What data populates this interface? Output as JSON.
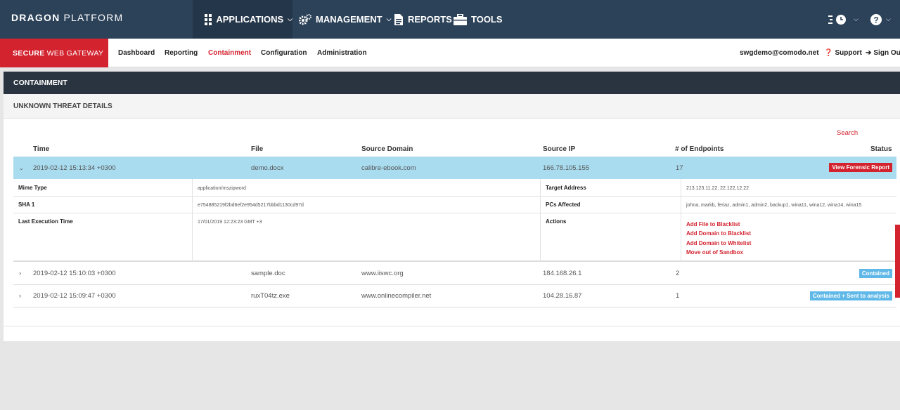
{
  "header": {
    "brand_bold": "DRAGON",
    "brand_light": "PLATFORM",
    "nav": [
      {
        "label": "APPLICATIONS",
        "icon": "grid-icon"
      },
      {
        "label": "MANAGEMENT",
        "icon": "gears-icon"
      },
      {
        "label": "REPORTS",
        "icon": "document-icon"
      },
      {
        "label": "TOOLS",
        "icon": "toolbox-icon"
      }
    ]
  },
  "subbar": {
    "product_bold": "SECURE",
    "product_light": "WEB GATEWAY",
    "nav": [
      "Dashboard",
      "Reporting",
      "Containment",
      "Configuration",
      "Administration"
    ],
    "active": "Containment",
    "user": "swgdemo@comodo.net",
    "support": "Support",
    "signout": "Sign Ou"
  },
  "panel": {
    "title": "CONTAINMENT",
    "subtitle": "UNKNOWN THREAT DETAILS",
    "search_label": "Search"
  },
  "table": {
    "headers": [
      "Time",
      "File",
      "Source Domain",
      "Source IP",
      "# of Endpoints",
      "Status"
    ],
    "rows": [
      {
        "time": "2019-02-12 15:13:34 +0300",
        "file": "demo.docx",
        "domain": "calibre-ebook.com",
        "ip": "166.78.105.155",
        "endpoints": "17",
        "status": "View Forensic Report",
        "expanded": true
      },
      {
        "time": "2019-02-12 15:10:03 +0300",
        "file": "sample.doc",
        "domain": "www.iiswc.org",
        "ip": "184.168.26.1",
        "endpoints": "2",
        "status": "Contained",
        "expanded": false
      },
      {
        "time": "2019-02-12 15:09:47 +0300",
        "file": "ruxT04tz.exe",
        "domain": "www.onlinecompiler.net",
        "ip": "104.28.16.87",
        "endpoints": "1",
        "status": "Contained + Sent to analysis",
        "expanded": false
      }
    ]
  },
  "details": {
    "mime_label": "Mime Type",
    "mime_value": "application/mszipword",
    "sha_label": "SHA 1",
    "sha_value": "e754885219f2bd6ef2e954d5217bbbd1130cd97d",
    "exec_label": "Last Execution Time",
    "exec_value": "17/01/2019 12:23:23 GMT +3",
    "target_label": "Target Address",
    "target_value": "213.123.11.22, 22.122,12.22",
    "pcs_label": "PCs Affected",
    "pcs_value": "johna, markb, feriaz, admin1, admin2, backup1, wina11, wina12, wina14, wina15",
    "actions_label": "Actions",
    "actions": [
      "Add File to Blacklist",
      "Add Domain to Blacklist",
      "Add Domain to Whitelist",
      "Move out of Sandbox"
    ]
  }
}
